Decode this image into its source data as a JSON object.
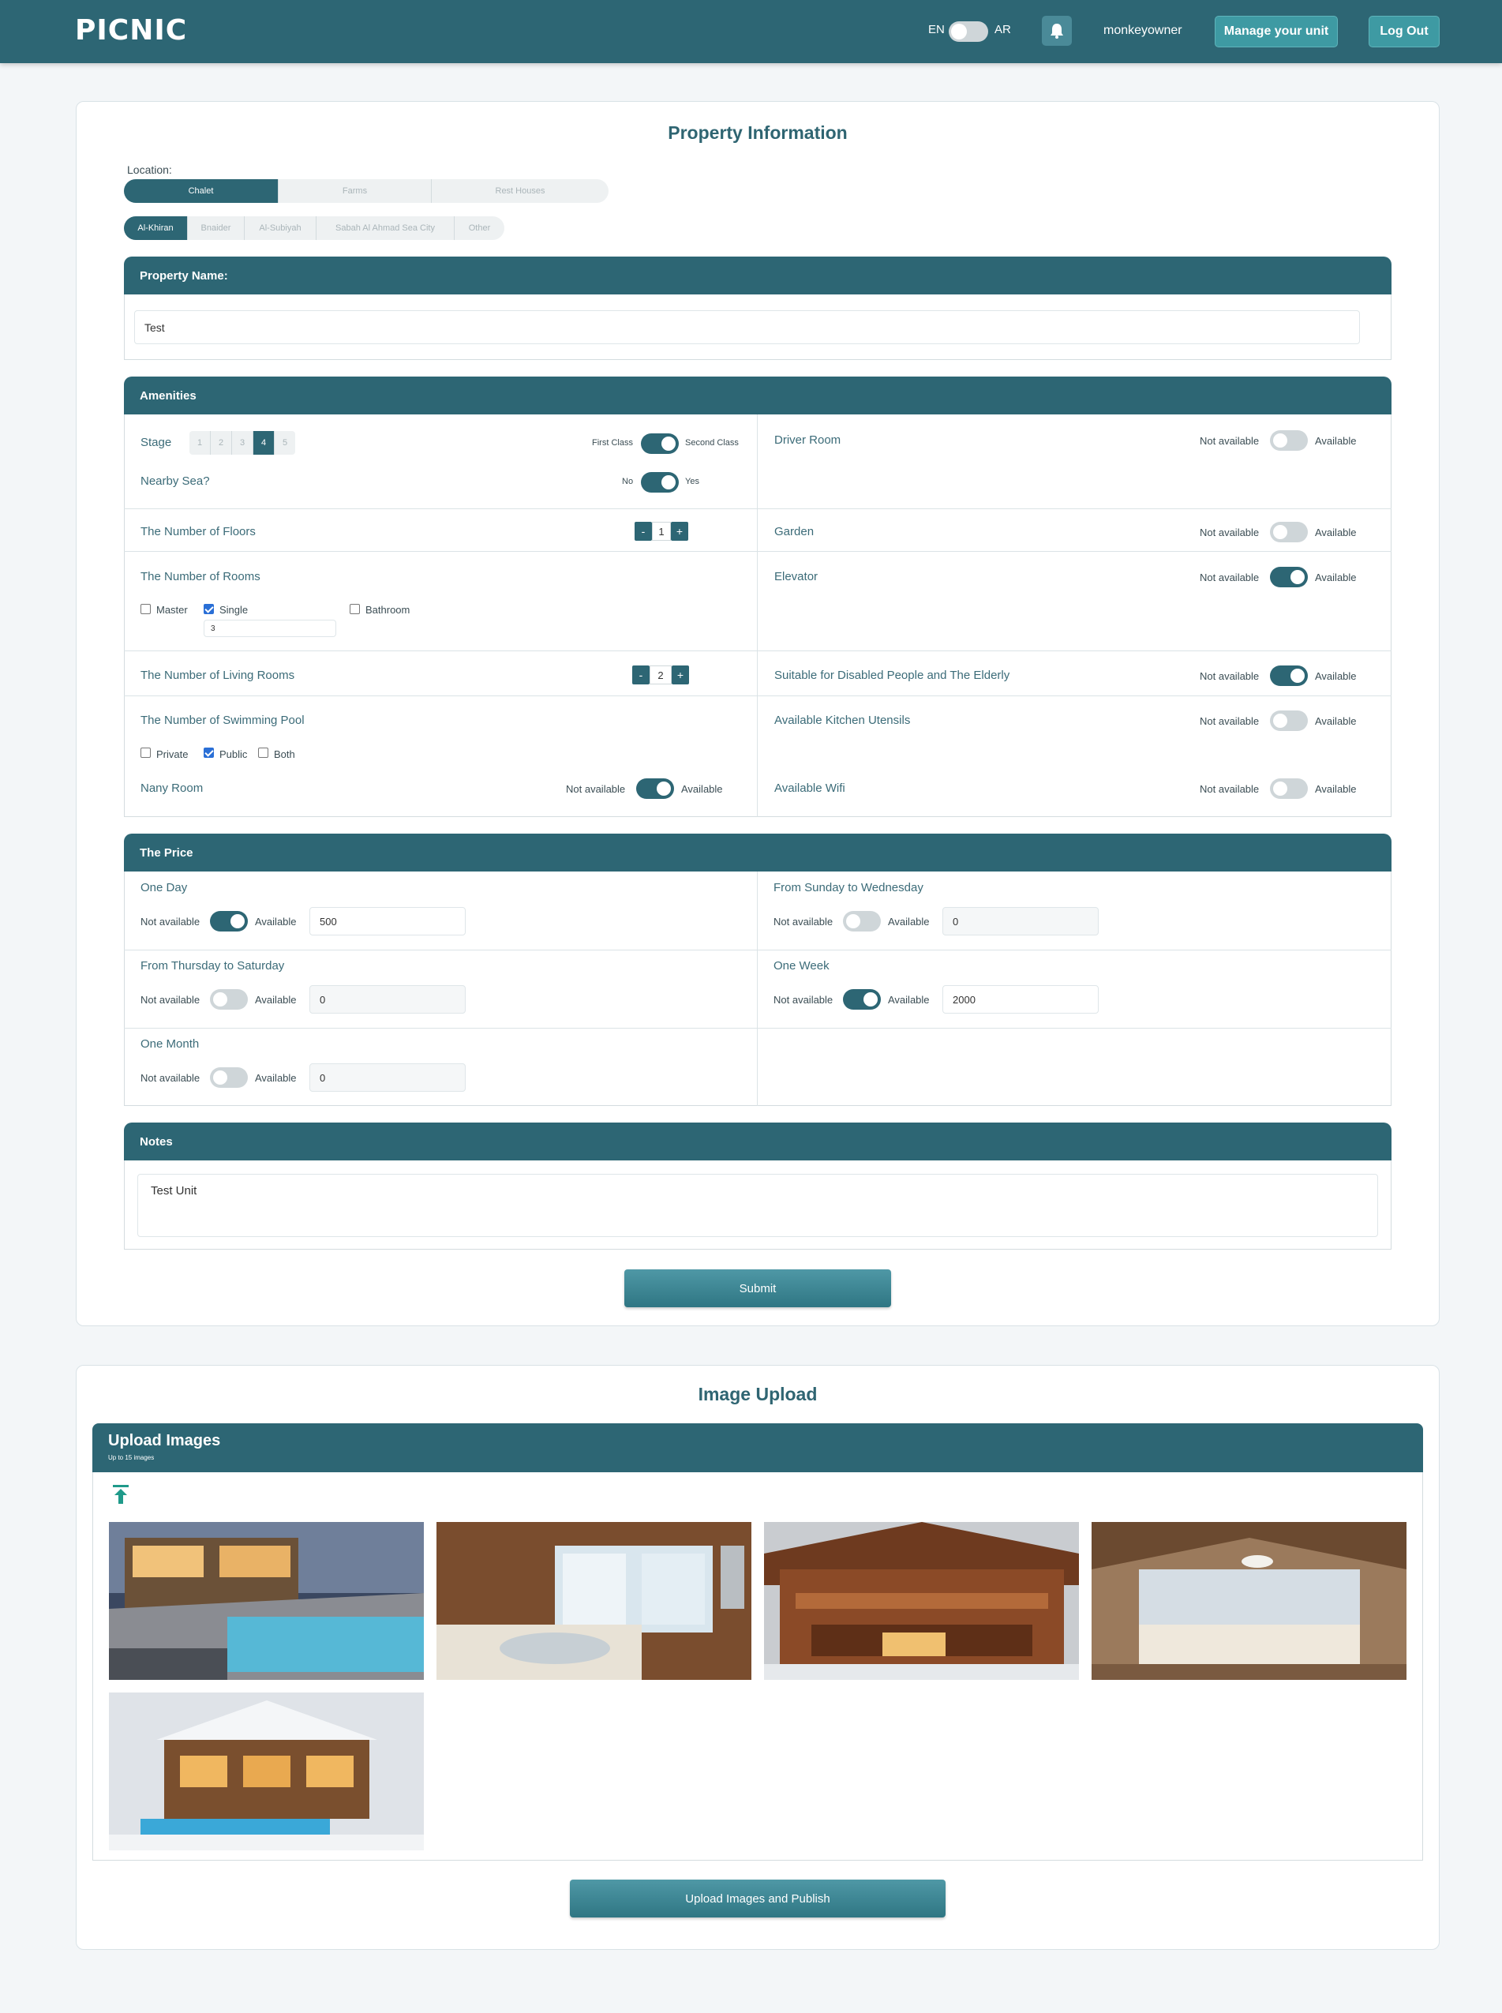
{
  "header": {
    "logo": "PICNIC",
    "lang_en": "EN",
    "lang_ar": "AR",
    "username": "monkeyowner",
    "manage_label": "Manage your unit",
    "logout_label": "Log Out"
  },
  "property": {
    "title": "Property Information",
    "location_label": "Location:",
    "types": [
      "Chalet",
      "Farms",
      "Rest Houses"
    ],
    "areas": [
      "Al-Khiran",
      "Bnaider",
      "Al-Subiyah",
      "Sabah Al Ahmad Sea City",
      "Other"
    ],
    "name_header": "Property Name:",
    "name_value": "Test"
  },
  "amenities": {
    "header": "Amenities",
    "stage_label": "Stage",
    "stages": [
      "1",
      "2",
      "3",
      "4",
      "5"
    ],
    "stage_selected": "4",
    "first_class": "First Class",
    "second_class": "Second Class",
    "nearby_sea": "Nearby Sea?",
    "no": "No",
    "yes": "Yes",
    "floors_label": "The Number of Floors",
    "floors_value": "1",
    "rooms_label": "The Number of Rooms",
    "master": "Master",
    "single": "Single",
    "bathroom": "Bathroom",
    "single_count": "3",
    "living_label": "The Number of Living Rooms",
    "living_value": "2",
    "pool_label": "The Number of Swimming Pool",
    "private": "Private",
    "public": "Public",
    "both": "Both",
    "nany_label": "Nany Room",
    "minus": "-",
    "plus": "+",
    "not_available": "Not available",
    "available": "Available",
    "driver_room": "Driver Room",
    "garden": "Garden",
    "elevator": "Elevator",
    "disabled": "Suitable for Disabled People and The Elderly",
    "kitchen": "Available Kitchen Utensils",
    "wifi": "Available Wifi"
  },
  "price": {
    "header": "The Price",
    "one_day": "One Day",
    "one_day_value": "500",
    "sun_wed": "From Sunday to Wednesday",
    "sun_wed_value": "0",
    "thu_sat": "From Thursday to Saturday",
    "thu_sat_value": "0",
    "one_week": "One Week",
    "one_week_value": "2000",
    "one_month": "One Month",
    "one_month_value": "0"
  },
  "notes": {
    "header": "Notes",
    "value": "Test Unit"
  },
  "submit_label": "Submit",
  "upload": {
    "title": "Image Upload",
    "header": "Upload Images",
    "subheader": "Up to 15 images",
    "publish_label": "Upload Images and Publish"
  },
  "colors": {
    "primary": "#2d6674",
    "accent": "#3e9aa3"
  }
}
